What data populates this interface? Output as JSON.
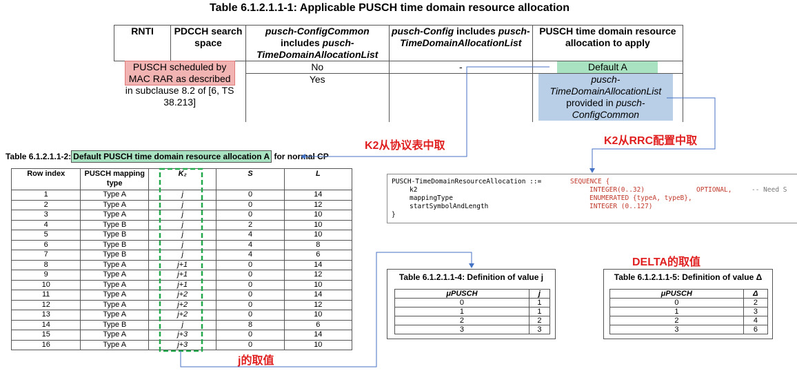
{
  "table1": {
    "title": "Table 6.1.2.1.1-1: Applicable PUSCH time domain resource allocation",
    "headers": {
      "rnti": "RNTI",
      "pdcch": "PDCCH search space",
      "common_a": "pusch-ConfigCommon",
      "common_b": "includes",
      "common_c": "pusch-TimeDomainAllocationList",
      "config_a": "pusch-Config",
      "config_b": "includes",
      "config_c": "pusch-TimeDomainAllocationList",
      "apply": "PUSCH time domain resource allocation to apply"
    },
    "row_label_hl": "PUSCH scheduled by MAC RAR as described",
    "row_label_rest": "in subclause 8.2 of [6, TS 38.213]",
    "row1": {
      "common": "No",
      "config": "-",
      "apply": "Default A"
    },
    "row2": {
      "common": "Yes",
      "apply_a": "pusch-TimeDomainAllocationList",
      "apply_b": "provided in",
      "apply_c": "pusch-ConfigCommon"
    }
  },
  "annotations": {
    "k2_table": "K2从协议表中取",
    "k2_rrc": "K2从RRC配置中取",
    "delta": "DELTA的取值",
    "j": "j的取值"
  },
  "table2": {
    "title_pre": "Table 6.1.2.1.1-2:",
    "title_hl": "Default PUSCH time domain resource allocation A",
    "title_post": "for normal CP",
    "headers": {
      "row": "Row index",
      "type": "PUSCH mapping type",
      "k2": "K₂",
      "s": "S",
      "l": "L"
    },
    "rows": [
      [
        "1",
        "Type A",
        "j",
        "0",
        "14"
      ],
      [
        "2",
        "Type A",
        "j",
        "0",
        "12"
      ],
      [
        "3",
        "Type A",
        "j",
        "0",
        "10"
      ],
      [
        "4",
        "Type B",
        "j",
        "2",
        "10"
      ],
      [
        "5",
        "Type B",
        "j",
        "4",
        "10"
      ],
      [
        "6",
        "Type B",
        "j",
        "4",
        "8"
      ],
      [
        "7",
        "Type B",
        "j",
        "4",
        "6"
      ],
      [
        "8",
        "Type A",
        "j+1",
        "0",
        "14"
      ],
      [
        "9",
        "Type A",
        "j+1",
        "0",
        "12"
      ],
      [
        "10",
        "Type A",
        "j+1",
        "0",
        "10"
      ],
      [
        "11",
        "Type A",
        "j+2",
        "0",
        "14"
      ],
      [
        "12",
        "Type A",
        "j+2",
        "0",
        "12"
      ],
      [
        "13",
        "Type A",
        "j+2",
        "0",
        "10"
      ],
      [
        "14",
        "Type B",
        "j",
        "8",
        "6"
      ],
      [
        "15",
        "Type A",
        "j+3",
        "0",
        "14"
      ],
      [
        "16",
        "Type A",
        "j+3",
        "0",
        "10"
      ]
    ]
  },
  "code": {
    "l1_a": "PUSCH-TimeDomainResourceAllocation ::=",
    "l1_b": "SEQUENCE {",
    "l2_a": "k2",
    "l2_b": "INTEGER(0..32)",
    "l2_c": "OPTIONAL,",
    "l2_d": "-- Need S",
    "l3_a": "mappingType",
    "l3_b": "ENUMERATED {typeA, typeB},",
    "l4_a": "startSymbolAndLength",
    "l4_b": "INTEGER (0..127)",
    "l5": "}"
  },
  "table4": {
    "title": "Table 6.1.2.1.1-4: Definition of value j",
    "h1": "μPUSCH",
    "h2": "j",
    "rows": [
      [
        "0",
        "1"
      ],
      [
        "1",
        "1"
      ],
      [
        "2",
        "2"
      ],
      [
        "3",
        "3"
      ]
    ]
  },
  "table5": {
    "title": "Table 6.1.2.1.1-5: Definition of value Δ",
    "h1": "μPUSCH",
    "h2": "Δ",
    "rows": [
      [
        "0",
        "2"
      ],
      [
        "1",
        "3"
      ],
      [
        "2",
        "4"
      ],
      [
        "3",
        "6"
      ]
    ]
  },
  "colors": {
    "pink": "#f2b3b3",
    "green": "#a9e2c0",
    "blue": "#b9cfe8",
    "red": "#e02020",
    "arrow": "#4472c4",
    "dash": "#22a84a"
  }
}
